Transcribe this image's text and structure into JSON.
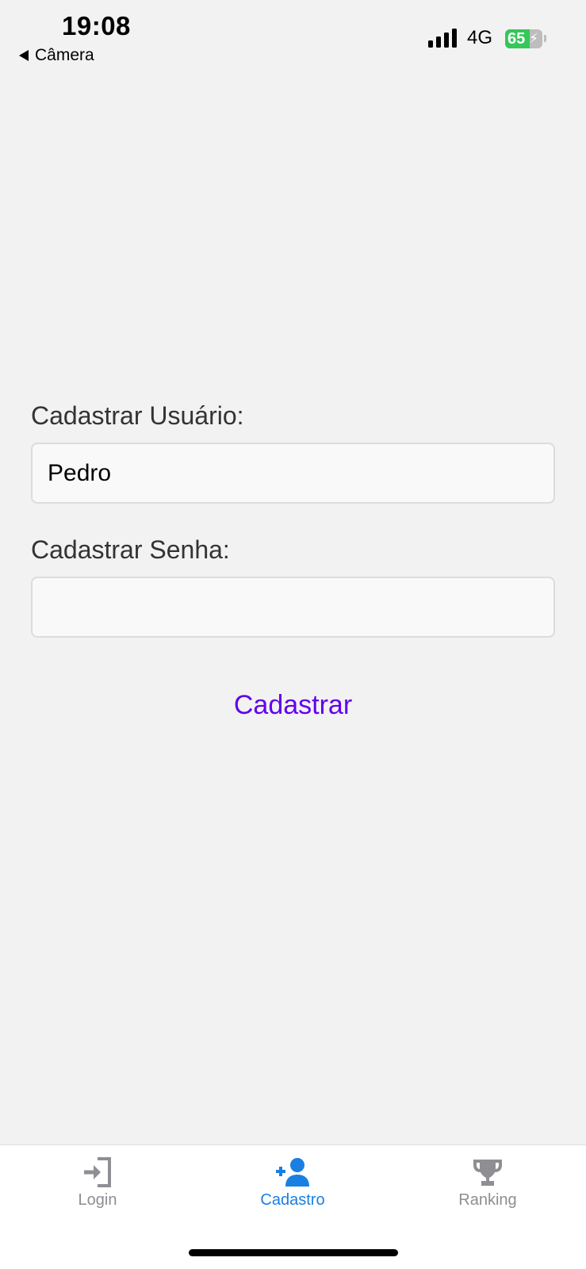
{
  "status_bar": {
    "time": "19:08",
    "back_app_label": "Câmera",
    "network": "4G",
    "battery_percent": "65",
    "battery_level": 0.65
  },
  "form": {
    "username_label": "Cadastrar Usuário:",
    "username_value": "Pedro",
    "password_label": "Cadastrar Senha:",
    "password_value": "",
    "submit_label": "Cadastrar",
    "accent_color": "#6200ee"
  },
  "tabs": [
    {
      "label": "Login",
      "icon": "login-icon",
      "active": false
    },
    {
      "label": "Cadastro",
      "icon": "add-user-icon",
      "active": true
    },
    {
      "label": "Ranking",
      "icon": "trophy-icon",
      "active": false
    }
  ],
  "colors": {
    "active_tab": "#1a7fe3",
    "inactive_tab": "#8e8e93",
    "background": "#f2f2f2"
  }
}
